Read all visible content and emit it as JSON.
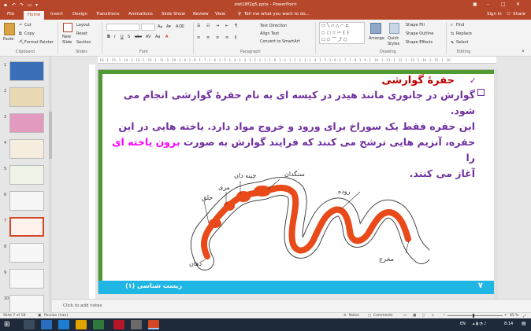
{
  "app": {
    "title": "ziet18f2g5.pptx - PowerPoint",
    "signin": "Sign in",
    "share": "Share"
  },
  "tabs": [
    "File",
    "Home",
    "Insert",
    "Design",
    "Transitions",
    "Animations",
    "Slide Show",
    "Review",
    "View"
  ],
  "tell_me": "Tell me what you want to do...",
  "ribbon": {
    "clipboard": {
      "paste": "Paste",
      "cut": "Cut",
      "copy": "Copy",
      "format_painter": "Format Painter",
      "label": "Clipboard"
    },
    "slides": {
      "new_slide": "New",
      "new_slide2": "Slide",
      "layout": "Layout",
      "reset": "Reset",
      "section": "Section",
      "label": "Slides"
    },
    "font": {
      "label": "Font"
    },
    "paragraph": {
      "text_direction": "Text Direction",
      "align_text": "Align Text",
      "smartart": "Convert to SmartArt",
      "label": "Paragraph"
    },
    "drawing": {
      "arrange": "Arrange",
      "quick": "Quick",
      "styles": "Styles",
      "shape_fill": "Shape Fill",
      "shape_outline": "Shape Outline",
      "shape_effects": "Shape Effects",
      "label": "Drawing"
    },
    "editing": {
      "find": "Find",
      "replace": "Replace",
      "select": "Select",
      "label": "Editing"
    }
  },
  "thumbnails": [
    {
      "num": "1",
      "color": "#3a6fb8"
    },
    {
      "num": "2",
      "color": "#e9d9b4"
    },
    {
      "num": "3",
      "color": "#e29abf"
    },
    {
      "num": "4",
      "color": "#f5eede"
    },
    {
      "num": "5",
      "color": "#eef4e8"
    },
    {
      "num": "6",
      "color": "#f7f7f7"
    },
    {
      "num": "7",
      "color": "#fff1ec"
    },
    {
      "num": "8",
      "color": "#f7f7f7"
    },
    {
      "num": "9",
      "color": "#f7f7f7"
    },
    {
      "num": "10",
      "color": "#f7f7f7"
    }
  ],
  "ruler": "· 16 · 1 · 15 · 1 · 14 · 1 · 13 · 1 · 12 · 1 · 11 · 1 · 10 · 1 · 9 · 1 · 8 · 1 · 7 · 1 · 6 · 1 · 5 · 1 · 4 · 1 · 3 · 1 · 2 · 1 · 1 · 1 · 0 · 1 · 1 · 1 · 2 · 1 · 3 · 1 · 4 · 1 · 5 · 1 · 6 · 1 · 7 · 1 · 8 · 1 · 9 · 1 · 10 · 1 · 11 · 1 · 12 · 1 · 13 · 1 · 14 · 1 · 15 · 1 · 16 ·",
  "slide": {
    "heading": "حفرهٔ گوارشی",
    "line1": "گوارش در جانوری مانند هیدر در کیسه ای به نام حفرهٔ گوارشی انجام می شود.",
    "line2": "این حفره فقط یک سوراخ برای ورود و خروج مواد دارد. یاخته هایی در این",
    "line3a": "حفره، آنزیم هایی ترشح می کنند که فرایند گوارش به صورت ",
    "line3b": "برون یاخته ای",
    "line3c": " را",
    "line4": "آغاز می کنند.",
    "labels": {
      "ventriculus": "سنگدان",
      "crop": "چینه دان",
      "esophagus": "مری",
      "pharynx": "حلق",
      "intestine": "روده",
      "mouth": "دهان",
      "anus": "مخرج"
    },
    "footer_title": "زیست شناسی (۱)",
    "page_num": "۷"
  },
  "notes_placeholder": "Click to add notes",
  "status": {
    "slide": "Slide 7 of 18",
    "lang": "Persian (Iran)",
    "notes": "Notes",
    "comments": "Comments",
    "zoom": "85 %"
  },
  "taskbar": {
    "lang": "EN",
    "time": "8:14"
  }
}
